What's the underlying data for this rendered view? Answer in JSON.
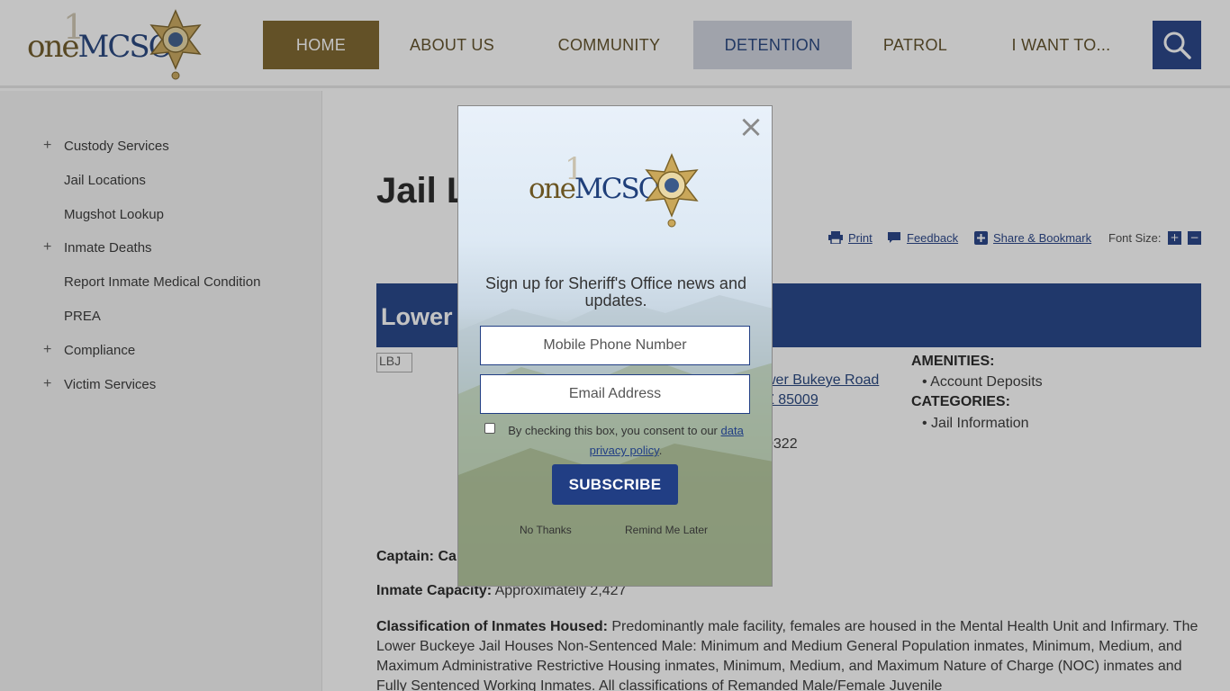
{
  "header": {
    "logo_prefix": "one",
    "logo_suffix": "MCSO",
    "logo_ghost": "1",
    "nav": [
      "HOME",
      "ABOUT US",
      "COMMUNITY",
      "DETENTION",
      "PATROL",
      "I WANT TO..."
    ],
    "search_icon": "search-icon"
  },
  "sidebar": {
    "items": [
      {
        "label": "Custody Services",
        "expandable": true
      },
      {
        "label": "Jail Locations",
        "expandable": false
      },
      {
        "label": "Mugshot Lookup",
        "expandable": false
      },
      {
        "label": "Inmate Deaths",
        "expandable": true
      },
      {
        "label": "Report Inmate Medical Condition",
        "expandable": false
      },
      {
        "label": "PREA",
        "expandable": false
      },
      {
        "label": "Compliance",
        "expandable": true
      },
      {
        "label": "Victim Services",
        "expandable": true
      }
    ],
    "plus": "+"
  },
  "main": {
    "title": "Jail L",
    "tools": {
      "print": "Print",
      "feedback": "Feedback",
      "share": "Share & Bookmark",
      "font_size": "Font Size:",
      "plus": "+",
      "minus": "−"
    },
    "band_title": "Lower",
    "image_alt": "LBJ",
    "address_line1": "wer Bukeye Road",
    "address_line2": "Z 85009",
    "phone": "0322",
    "amenities_heading": "AMENITIES:",
    "amenities": [
      "Account Deposits"
    ],
    "categories_heading": "CATEGORIES:",
    "categories": [
      "Jail Information"
    ],
    "captain": "Captain: Ca",
    "capacity_label": "Inmate Capacity:",
    "capacity_value": " Approximately 2,427",
    "classification_label": "Classification of Inmates Housed:",
    "classification_text": " Predominantly male facility, females are housed in the Mental Health Unit and Infirmary. The Lower Buckeye Jail Houses Non-Sentenced Male: Minimum and Medium General Population inmates, Minimum, Medium, and Maximum Administrative Restrictive Housing inmates, Minimum, Medium, and Maximum Nature of Charge (NOC) inmates and Fully Sentenced Working Inmates. All classifications of Remanded Male/Female Juvenile"
  },
  "modal": {
    "close": "×",
    "heading": "Sign up for Sheriff's Office news and updates.",
    "phone_placeholder": "Mobile Phone Number",
    "email_placeholder": "Email Address",
    "consent_prefix": "By checking this box, you consent to our ",
    "consent_link": "data privacy policy",
    "consent_suffix": ".",
    "subscribe": "SUBSCRIBE",
    "no_thanks": "No Thanks",
    "remind": "Remind Me Later"
  },
  "colors": {
    "brand_blue": "#213e84",
    "brand_gold": "#7a6228",
    "band_blue": "#1e3f86"
  }
}
